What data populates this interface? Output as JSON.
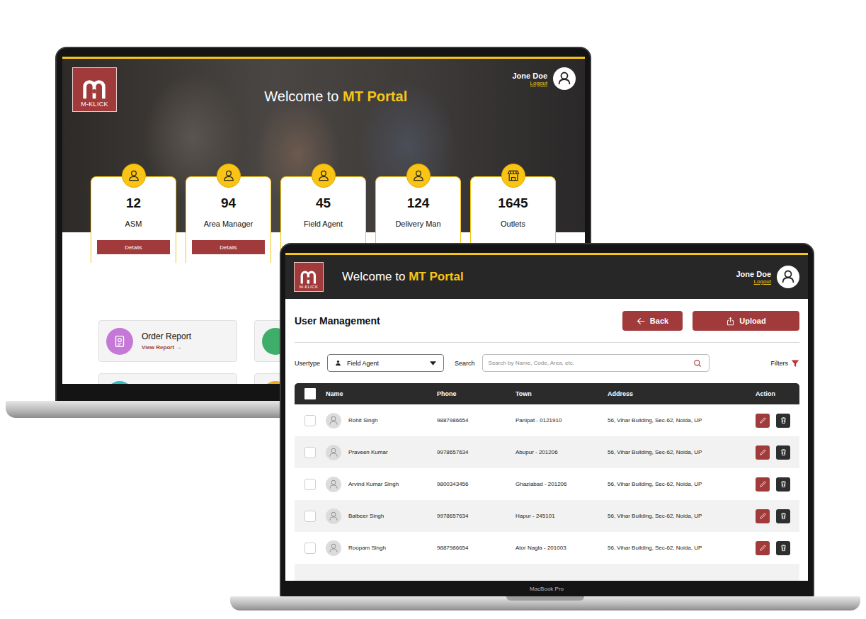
{
  "back_screen": {
    "logo": "M-KLICK",
    "welcome_prefix": "Welcome to",
    "welcome_highlight": "MT Portal",
    "user": {
      "name": "Jone Doe",
      "link": "Logout"
    },
    "stats": [
      {
        "kind": "person",
        "count": "12",
        "label": "ASM",
        "button": "Details"
      },
      {
        "kind": "person",
        "count": "94",
        "label": "Area Manager",
        "button": "Details"
      },
      {
        "kind": "person",
        "count": "45",
        "label": "Field Agent"
      },
      {
        "kind": "person",
        "count": "124",
        "label": "Delivery Man"
      },
      {
        "kind": "store",
        "count": "1645",
        "label": "Outlets"
      }
    ],
    "reports": [
      {
        "title": "Order Report",
        "link": "View Report →",
        "color": "#c678d6"
      }
    ]
  },
  "front_screen": {
    "logo": "M-KLICK",
    "welcome_prefix": "Welcome to",
    "welcome_highlight": "MT Portal",
    "user": {
      "name": "Jone Doe",
      "link": "Logout"
    },
    "page_title": "User Management",
    "buttons": [
      {
        "kind": "back",
        "label": "Back"
      },
      {
        "kind": "upload",
        "label": "Upload"
      }
    ],
    "usertype": {
      "label": "Usertype",
      "value": "Field Agent"
    },
    "search": {
      "label": "Search",
      "placeholder": "Search by Name, Code, Area, etc."
    },
    "filters": "Filters",
    "table": {
      "all_checked": false,
      "columns": [
        "Name",
        "Phone",
        "Town",
        "Address",
        "Action"
      ],
      "rows": [
        {
          "name": "Rohit Singh",
          "phone": "9887986654",
          "town": "Panipat - 0121910",
          "address": "56, Vihar Building, Sec-62, Noida, UP",
          "checked": false
        },
        {
          "name": "Praveen Kumar",
          "phone": "9978657634",
          "town": "Abupur - 201206",
          "address": "56, Vihar Building, Sec-62, Noida, UP",
          "checked": false
        },
        {
          "name": "Arvind Kumar Singh",
          "phone": "9800343456",
          "town": "Ghaziabad - 201206",
          "address": "56, Vihar Building, Sec-62, Noida, UP",
          "checked": false
        },
        {
          "name": "Balbeer Singh",
          "phone": "9978657634",
          "town": "Hapur - 245101",
          "address": "56, Vihar Building, Sec-62, Noida, UP",
          "checked": false
        },
        {
          "name": "Roopam Singh",
          "phone": "9887986654",
          "town": "Ator Nagla - 201003",
          "address": "56, Vihar Building, Sec-62, Noida, UP",
          "checked": false
        }
      ]
    }
  },
  "device_label": "MacBook Pro"
}
